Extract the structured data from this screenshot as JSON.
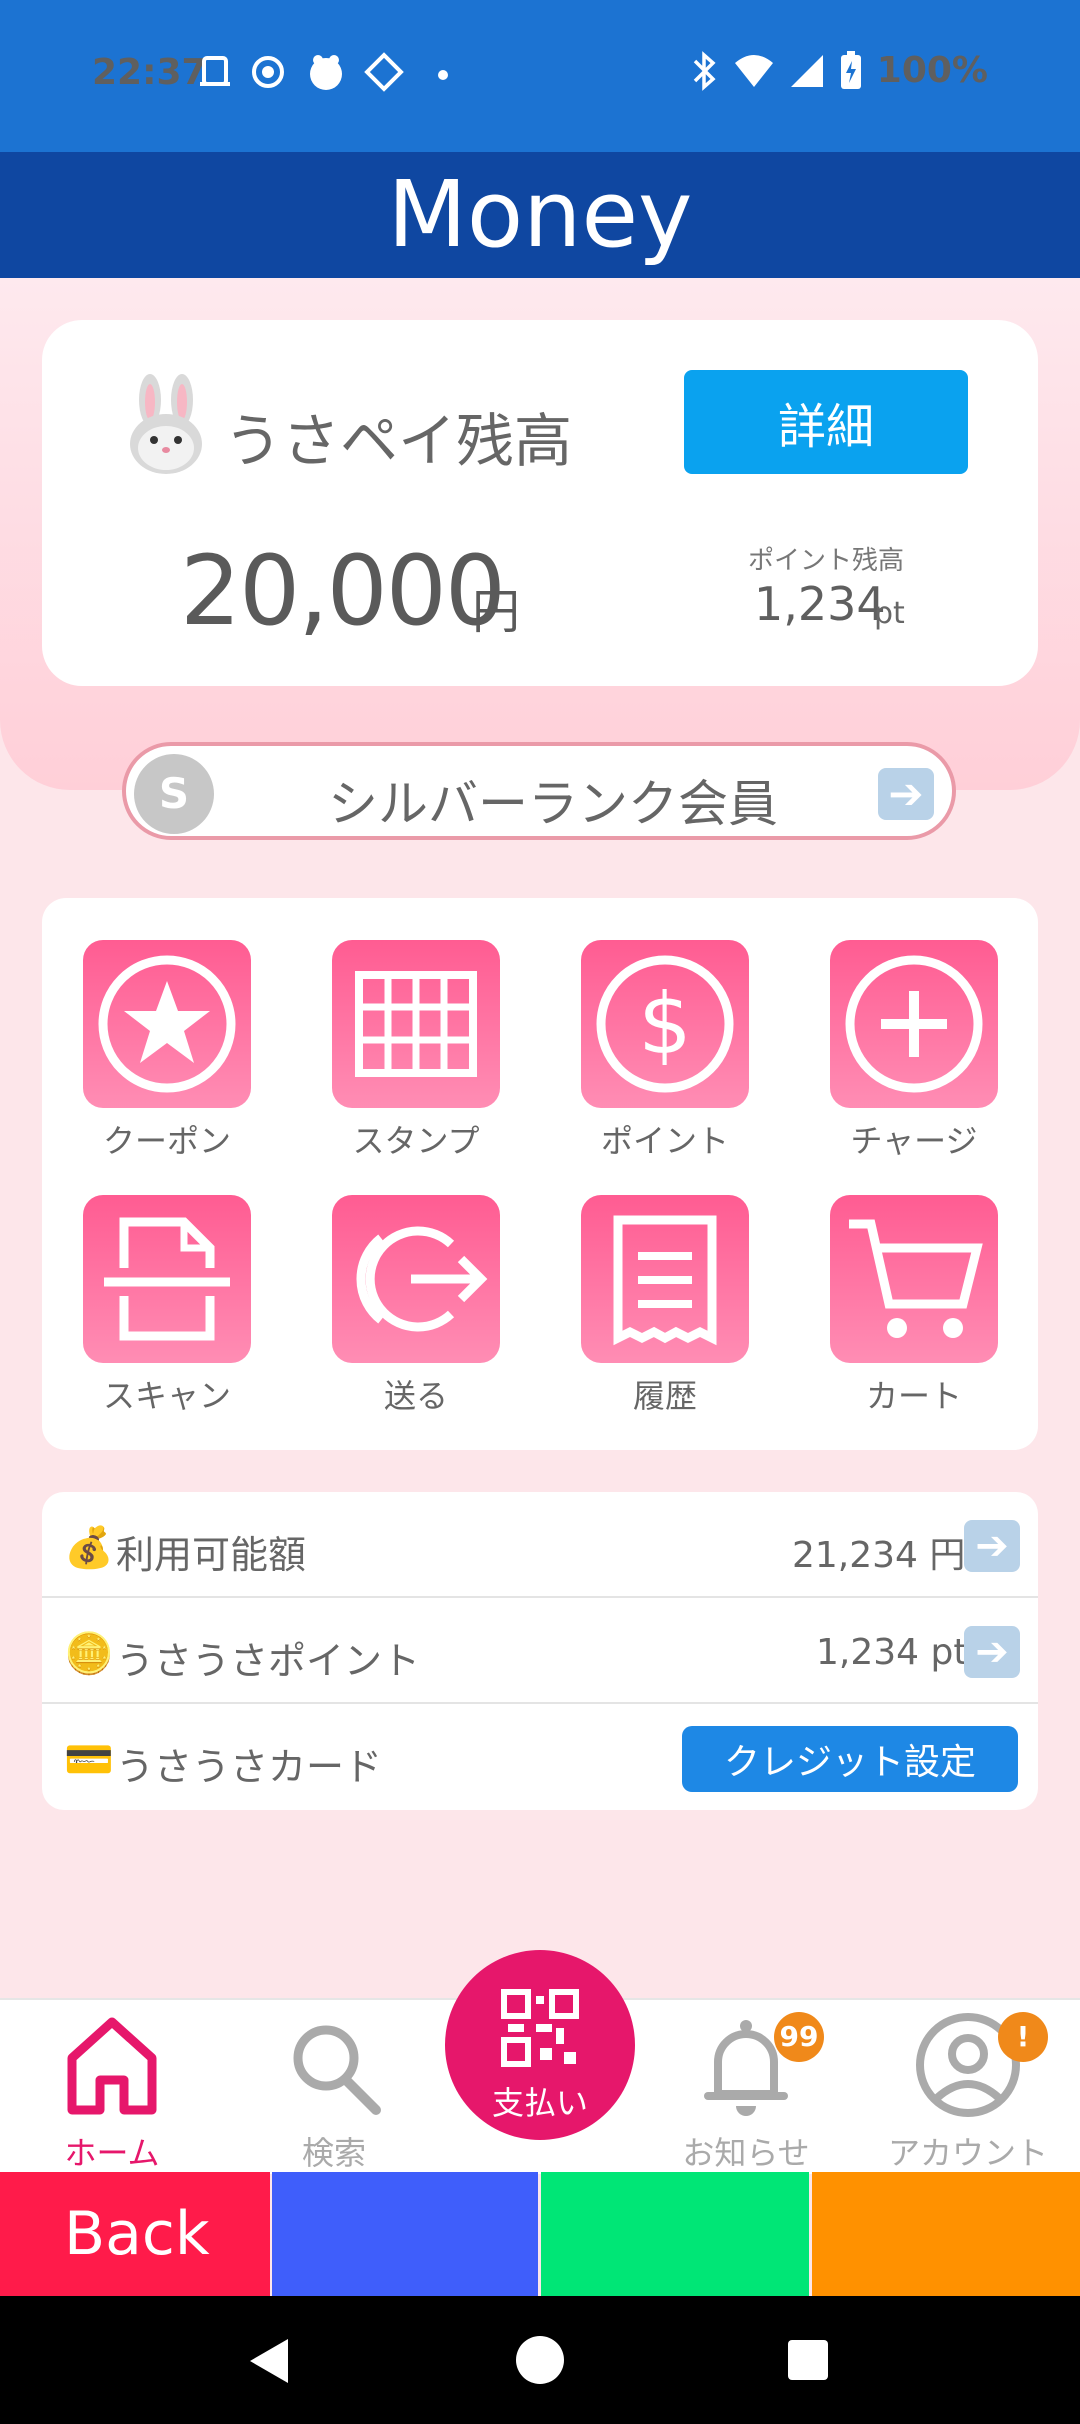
{
  "status_bar": {
    "time": "22:37",
    "battery": "100%"
  },
  "app_bar": {
    "title": "Money"
  },
  "balance": {
    "label": "うさペイ残高",
    "detail_button": "詳細",
    "amount": "20,000",
    "currency": "円",
    "points_caption": "ポイント残高",
    "points_value": "1,234",
    "points_unit": "pt"
  },
  "rank": {
    "badge": "S",
    "label": "シルバーランク会員"
  },
  "menu": [
    {
      "label": "クーポン",
      "icon": "coupon-star-icon"
    },
    {
      "label": "スタンプ",
      "icon": "stamp-grid-icon"
    },
    {
      "label": "ポイント",
      "icon": "point-dollar-icon"
    },
    {
      "label": "チャージ",
      "icon": "charge-plus-icon"
    },
    {
      "label": "スキャン",
      "icon": "scan-document-icon"
    },
    {
      "label": "送る",
      "icon": "send-arrow-icon"
    },
    {
      "label": "履歴",
      "icon": "receipt-history-icon"
    },
    {
      "label": "カート",
      "icon": "cart-icon"
    }
  ],
  "info_rows": [
    {
      "emoji": "💰",
      "label": "利用可能額",
      "value": "21,234 円"
    },
    {
      "emoji": "🪙",
      "label": "うさうさポイント",
      "value": "1,234 pt"
    },
    {
      "emoji": "💳",
      "label": "うさうさカード",
      "button": "クレジット設定"
    }
  ],
  "bottom_nav": {
    "home": "ホーム",
    "search": "検索",
    "pay": "支払い",
    "notifications": "お知らせ",
    "notifications_badge": "99",
    "account": "アカウント",
    "account_badge": "!"
  },
  "color_bar": {
    "back": "Back"
  },
  "colors": {
    "status_bar": "#1c73d2",
    "app_bar": "#0f47a1",
    "accent_pink": "#e6176b",
    "detail_button": "#0aa2ef",
    "back": "#ff1b4a",
    "blue": "#3f5efb",
    "green": "#00e676",
    "orange": "#ff9100"
  }
}
